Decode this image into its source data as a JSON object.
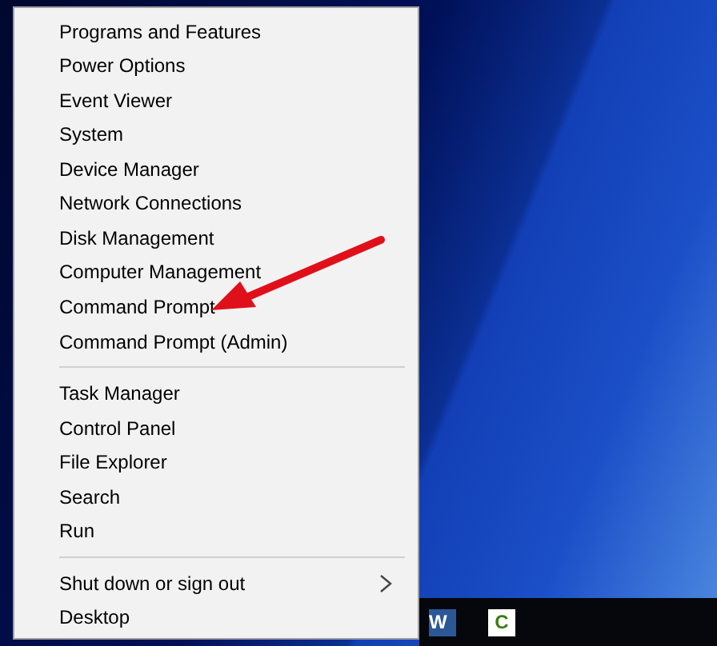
{
  "menu": {
    "groups": [
      {
        "items": [
          {
            "label": "Programs and Features",
            "has_submenu": false
          },
          {
            "label": "Power Options",
            "has_submenu": false
          },
          {
            "label": "Event Viewer",
            "has_submenu": false
          },
          {
            "label": "System",
            "has_submenu": false
          },
          {
            "label": "Device Manager",
            "has_submenu": false
          },
          {
            "label": "Network Connections",
            "has_submenu": false
          },
          {
            "label": "Disk Management",
            "has_submenu": false
          },
          {
            "label": "Computer Management",
            "has_submenu": false
          },
          {
            "label": "Command Prompt",
            "has_submenu": false
          },
          {
            "label": "Command Prompt (Admin)",
            "has_submenu": false
          }
        ]
      },
      {
        "items": [
          {
            "label": "Task Manager",
            "has_submenu": false
          },
          {
            "label": "Control Panel",
            "has_submenu": false
          },
          {
            "label": "File Explorer",
            "has_submenu": false
          },
          {
            "label": "Search",
            "has_submenu": false
          },
          {
            "label": "Run",
            "has_submenu": false
          }
        ]
      },
      {
        "items": [
          {
            "label": "Shut down or sign out",
            "has_submenu": true
          },
          {
            "label": "Desktop",
            "has_submenu": false
          }
        ]
      }
    ]
  },
  "taskbar": {
    "apps": [
      {
        "kind": "word",
        "letter": "W"
      },
      {
        "kind": "c",
        "letter": "C"
      }
    ]
  }
}
